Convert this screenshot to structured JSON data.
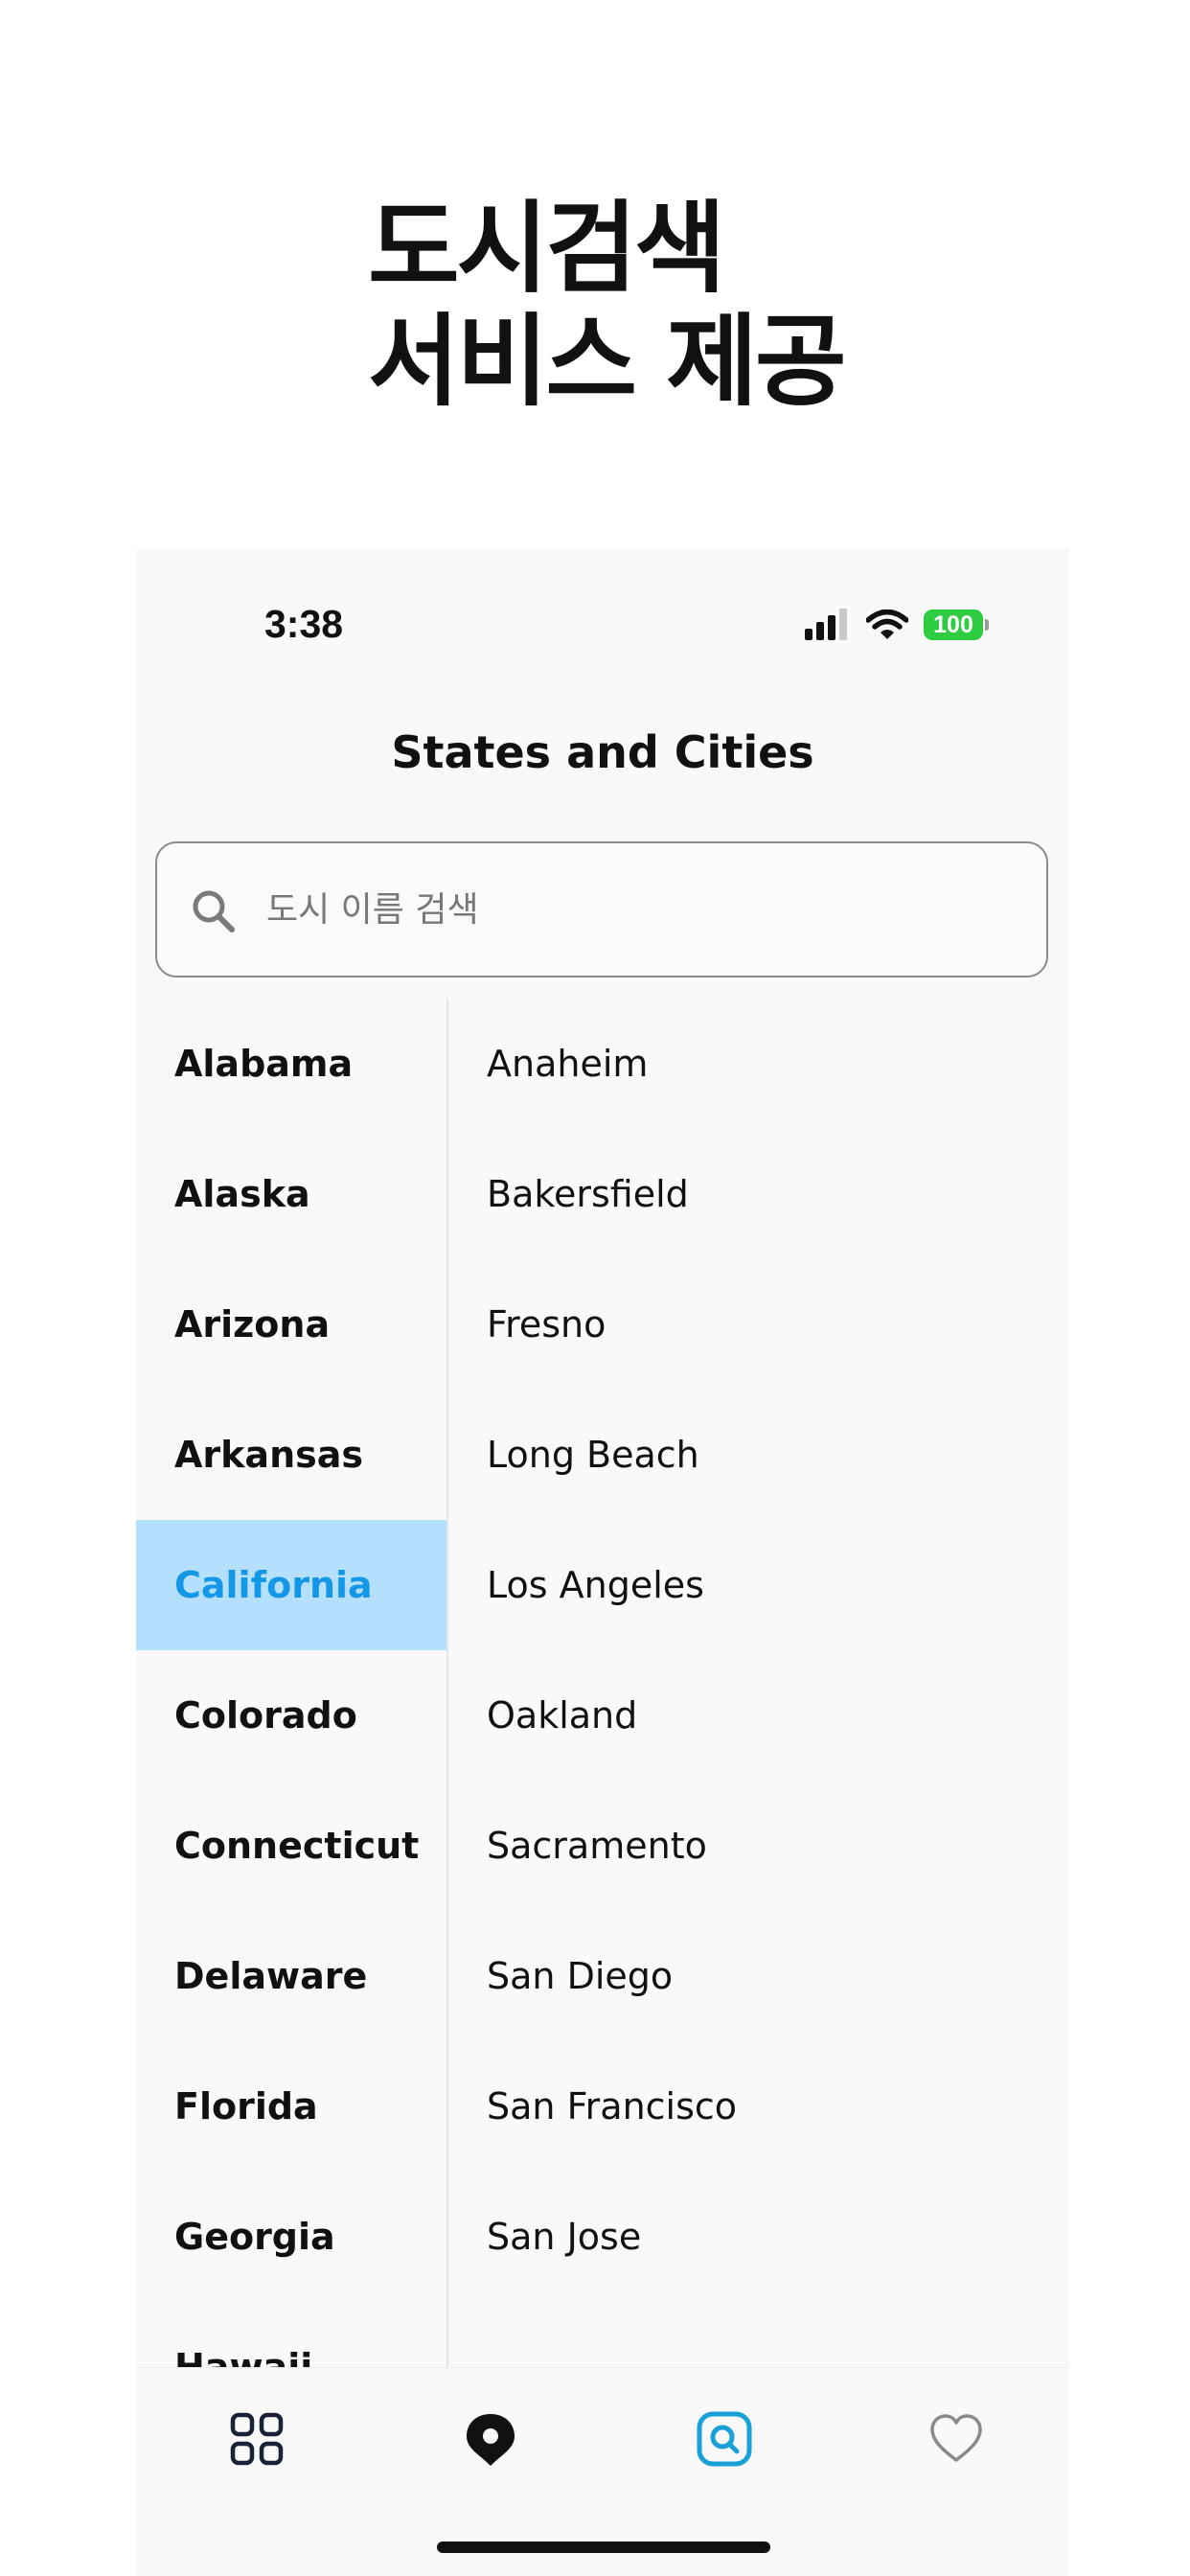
{
  "headline": {
    "line1": "도시검색",
    "line2": "서비스 제공"
  },
  "status_bar": {
    "time": "3:38",
    "battery": "100"
  },
  "nav": {
    "title": "States and Cities"
  },
  "search": {
    "placeholder": "도시 이름 검색"
  },
  "states": [
    {
      "label": "Alabama",
      "selected": false
    },
    {
      "label": "Alaska",
      "selected": false
    },
    {
      "label": "Arizona",
      "selected": false
    },
    {
      "label": "Arkansas",
      "selected": false
    },
    {
      "label": "California",
      "selected": true
    },
    {
      "label": "Colorado",
      "selected": false
    },
    {
      "label": "Connecticut",
      "selected": false
    },
    {
      "label": "Delaware",
      "selected": false
    },
    {
      "label": "Florida",
      "selected": false
    },
    {
      "label": "Georgia",
      "selected": false
    },
    {
      "label": "Hawaii",
      "selected": false
    }
  ],
  "cities": [
    "Anaheim",
    "Bakersfield",
    "Fresno",
    "Long Beach",
    "Los Angeles",
    "Oakland",
    "Sacramento",
    "San Diego",
    "San Francisco",
    "San Jose"
  ],
  "tabs": [
    {
      "icon": "grid-icon",
      "active": false
    },
    {
      "icon": "map-pin-icon",
      "active": false
    },
    {
      "icon": "search-icon",
      "active": true
    },
    {
      "icon": "heart-icon",
      "active": false
    }
  ],
  "colors": {
    "selected_bg": "#b5e0fd",
    "selected_text": "#1597e8",
    "active_tab": "#1aa0d8",
    "battery": "#2ecc40"
  }
}
